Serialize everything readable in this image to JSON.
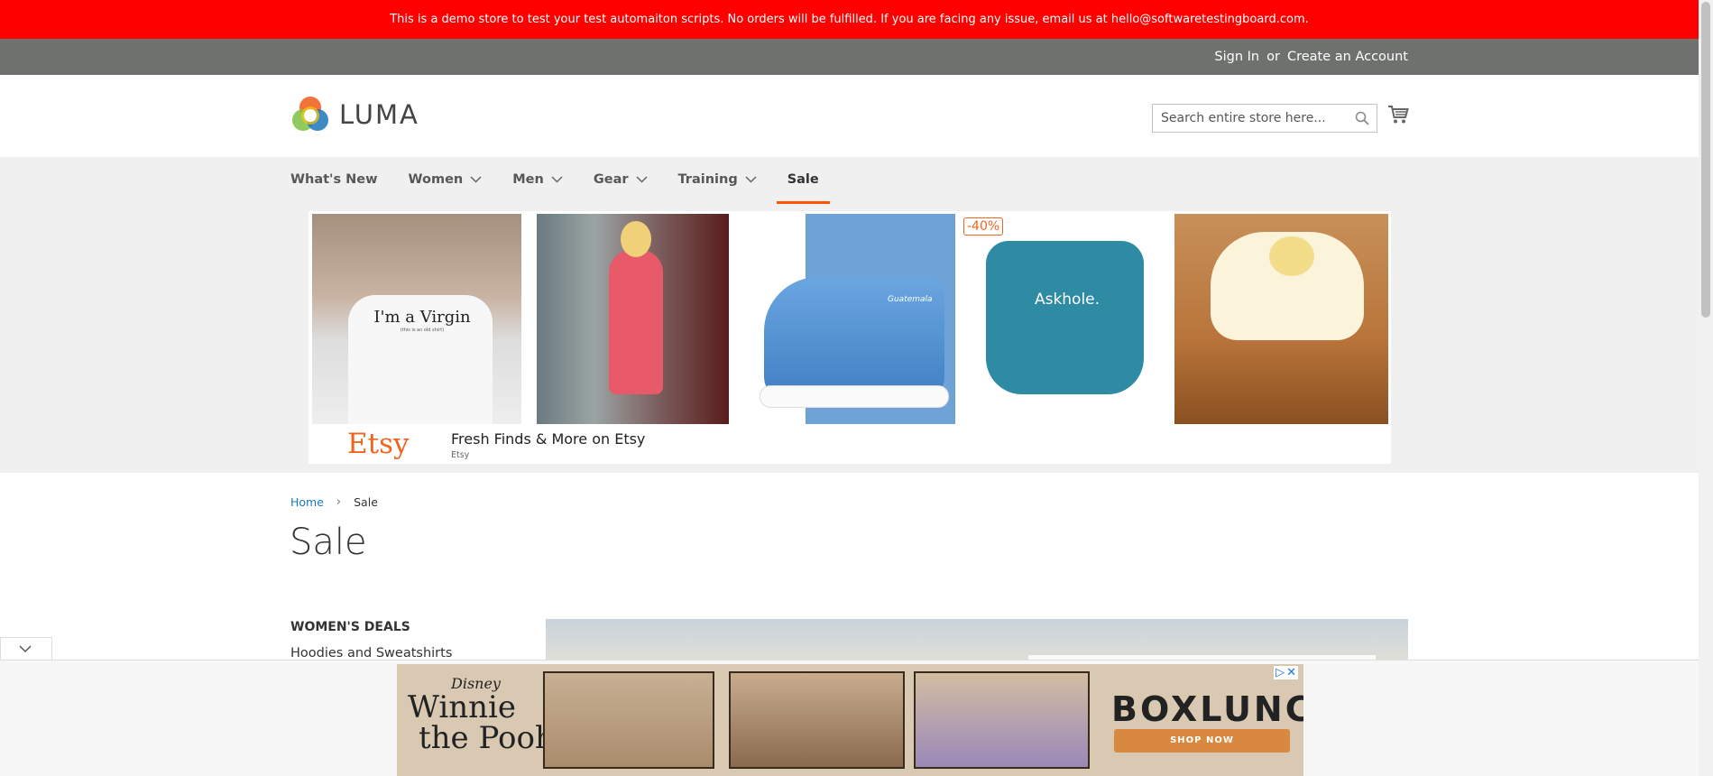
{
  "demo_banner": {
    "text": "This is a demo store to test your test automaiton scripts. No orders will be fulfilled. If you are facing any issue, email us at hello@softwaretestingboard.com."
  },
  "top_bar": {
    "sign_in": "Sign In",
    "or": "or",
    "create_account": "Create an Account"
  },
  "header": {
    "logo_text": "LUMA",
    "search_placeholder": "Search entire store here...",
    "icons": {
      "search": "search-icon",
      "cart": "cart-icon",
      "logo": "luma-logo-icon"
    }
  },
  "nav": {
    "items": [
      {
        "label": "What's New",
        "has_dropdown": false
      },
      {
        "label": "Women",
        "has_dropdown": true
      },
      {
        "label": "Men",
        "has_dropdown": true
      },
      {
        "label": "Gear",
        "has_dropdown": true
      },
      {
        "label": "Training",
        "has_dropdown": true
      },
      {
        "label": "Sale",
        "has_dropdown": false,
        "active": true
      }
    ],
    "active_color": "#ff5501"
  },
  "ad_banner": {
    "tiles": [
      {
        "shirt_text": "I'm a Virgin",
        "shirt_sub": "(this is an old shirt)"
      },
      {
        "shirt_text": ""
      },
      {
        "shoe_text": "Guatemala"
      },
      {
        "badge": "-40%",
        "shirt_text": "Askhole."
      },
      {
        "shirt_text": ""
      }
    ],
    "brand": "Etsy",
    "title": "Fresh Finds & More on Etsy",
    "subtitle": "Etsy"
  },
  "breadcrumb": {
    "home": "Home",
    "current": "Sale"
  },
  "page_title": "Sale",
  "sidebar": {
    "section_title": "WOMEN'S DEALS",
    "links": [
      "Hoodies and Sweatshirts"
    ]
  },
  "bottom_ad": {
    "brand_small": "Disney",
    "title_line1": "Winnie",
    "title_line2": "the Pooh",
    "brand": "BOXLUNCH",
    "cta": "SHOP NOW"
  },
  "colors": {
    "banner_bg": "#ff0000",
    "top_bar_bg": "#6e716e",
    "nav_bg": "#f0f0f0",
    "link": "#1979c3",
    "etsy": "#f1641e"
  }
}
